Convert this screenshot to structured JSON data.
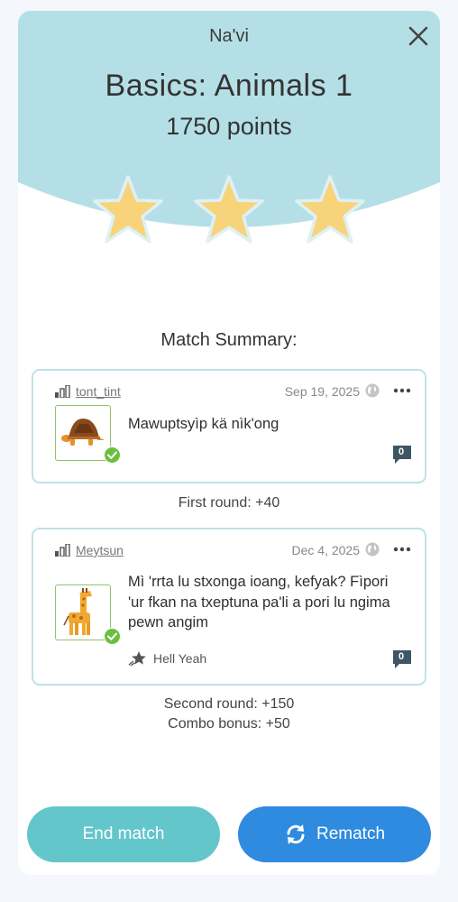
{
  "header": {
    "language": "Na'vi",
    "lesson_title": "Basics: Animals 1",
    "points": "1750 points",
    "stars_earned": 3,
    "stars_total": 3,
    "accent_color": "#b5dfe6",
    "star_color": "#f7d37a"
  },
  "summary": {
    "title": "Match Summary:",
    "entries": [
      {
        "username": "tont_tint",
        "date": "Sep 19, 2025",
        "image": "turtle-icon",
        "text": "Mawuptsyìp kä nìk'ong",
        "correct": true,
        "comment_count": "0",
        "reaction": ""
      },
      {
        "username": "Meytsun",
        "date": "Dec 4, 2025",
        "image": "giraffe-icon",
        "text_lines": [
          "Mì 'rrta lu stxonga ioang, kefyak? Fìpori",
          "'ur fkan na txeptuna pa'li a pori lu ngima",
          "pewn angim"
        ],
        "correct": true,
        "comment_count": "0",
        "reaction": "Hell Yeah"
      }
    ],
    "first_round": "First round: +40",
    "second_round": "Second round: +150",
    "combo_bonus": "Combo bonus: +50"
  },
  "actions": {
    "end_match": "End match",
    "rematch": "Rematch"
  }
}
